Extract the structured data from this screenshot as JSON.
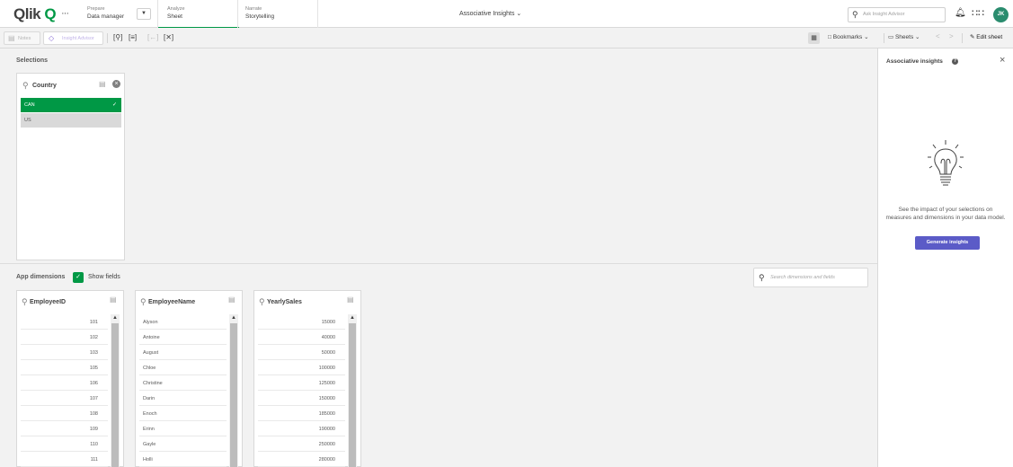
{
  "topbar": {
    "logo": {
      "text": "Qlik",
      "mark": "Q"
    },
    "more_icon": "···",
    "prepare": {
      "small": "Prepare",
      "big": "Data manager"
    },
    "dropdown_icon": "chevron-down-icon",
    "analyze": {
      "small": "Analyze",
      "big": "Sheet"
    },
    "narrate": {
      "small": "Narrate",
      "big": "Storytelling"
    },
    "app_title": "Associative Insights ⌄",
    "search_placeholder": "Ask Insight Advisor",
    "avatar_initials": "JK"
  },
  "toolbar": {
    "notes": "Notes",
    "insight_advisor": "Insight Advisor",
    "bookmarks": "Bookmarks ⌄",
    "sheets": "Sheets ⌄",
    "edit_sheet": "Edit sheet"
  },
  "selections": {
    "label": "Selections",
    "field": "Country",
    "values": [
      {
        "label": "CAN",
        "selected": true
      },
      {
        "label": "US",
        "selected": false
      }
    ]
  },
  "insights": {
    "title": "Associative insights",
    "description": "See the impact of your selections on measures and dimensions in your data model.",
    "button": "Generate insights"
  },
  "dimensions": {
    "label": "App dimensions",
    "show_fields": "Show fields",
    "show_fields_checked": true,
    "search_placeholder": "Search dimensions and fields",
    "fields": [
      {
        "title": "EmployeeID",
        "values": [
          "101",
          "102",
          "103",
          "105",
          "106",
          "107",
          "108",
          "109",
          "110",
          "111"
        ]
      },
      {
        "title": "EmployeeName",
        "values": [
          "Alyson",
          "Antoine",
          "August",
          "Chloe",
          "Christine",
          "Darin",
          "Enoch",
          "Erinn",
          "Gayle",
          "Holli"
        ]
      },
      {
        "title": "YearlySales",
        "values": [
          "15000",
          "40000",
          "50000",
          "100000",
          "125000",
          "150000",
          "185000",
          "190000",
          "250000",
          "280000"
        ]
      }
    ]
  },
  "colors": {
    "accent_green": "#009845",
    "insight_purple": "#5b5bc7",
    "avatar": "#2a8c6e"
  }
}
